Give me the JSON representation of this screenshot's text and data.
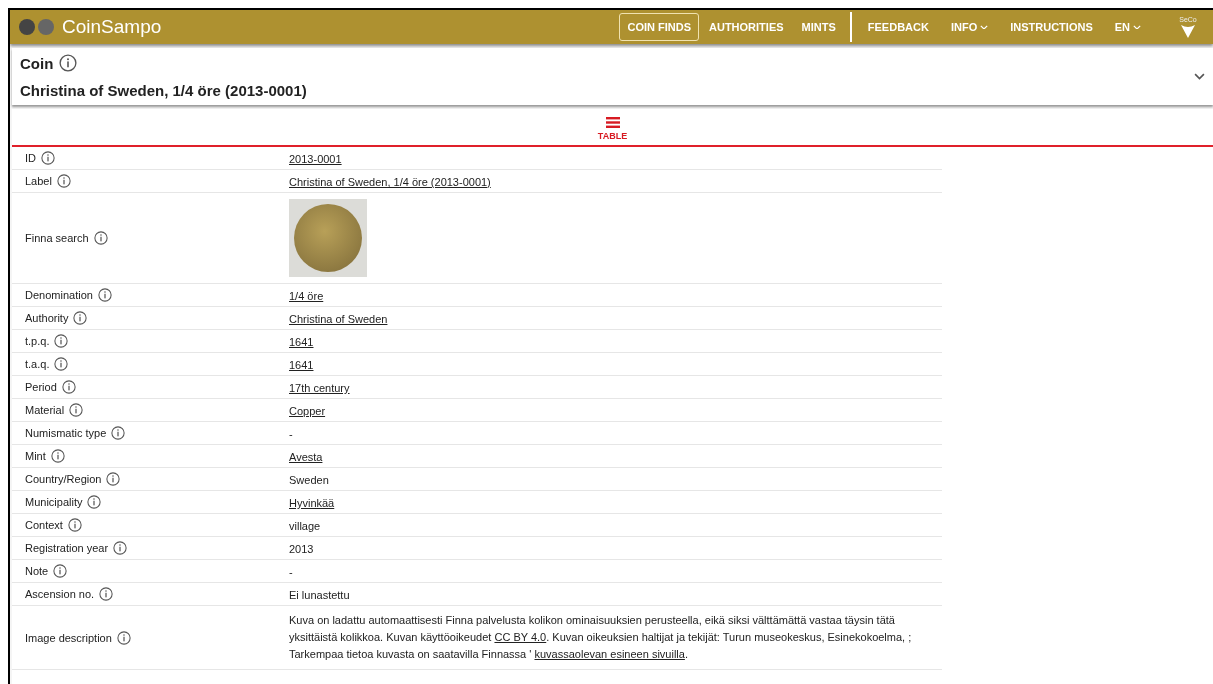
{
  "header": {
    "title": "CoinSampo",
    "nav": [
      {
        "label": "COIN FINDS",
        "selected": true,
        "dropdown": false
      },
      {
        "label": "AUTHORITIES",
        "selected": false,
        "dropdown": false
      },
      {
        "label": "MINTS",
        "selected": false,
        "dropdown": false
      }
    ],
    "nav_right": [
      {
        "label": "FEEDBACK",
        "dropdown": false
      },
      {
        "label": "INFO",
        "dropdown": true
      },
      {
        "label": "INSTRUCTIONS",
        "dropdown": false
      },
      {
        "label": "EN",
        "dropdown": true
      }
    ],
    "logo_text": "SeCo"
  },
  "panel": {
    "type": "Coin",
    "title": "Christina of Sweden, 1/4 öre (2013-0001)",
    "expanded": false
  },
  "tabs": [
    {
      "label": "TABLE",
      "selected": true
    }
  ],
  "rows": [
    {
      "label": "ID",
      "kind": "link",
      "value": "2013-0001"
    },
    {
      "label": "Label",
      "kind": "link",
      "value": "Christina of Sweden, 1/4 öre (2013-0001)"
    },
    {
      "label": "Finna search",
      "kind": "image"
    },
    {
      "label": "Denomination",
      "kind": "link",
      "value": "1/4 öre"
    },
    {
      "label": "Authority",
      "kind": "link",
      "value": "Christina of Sweden"
    },
    {
      "label": "t.p.q.",
      "kind": "link",
      "value": "1641"
    },
    {
      "label": "t.a.q.",
      "kind": "link",
      "value": "1641"
    },
    {
      "label": "Period",
      "kind": "link",
      "value": "17th century"
    },
    {
      "label": "Material",
      "kind": "link",
      "value": "Copper"
    },
    {
      "label": "Numismatic type",
      "kind": "text",
      "value": "-"
    },
    {
      "label": "Mint",
      "kind": "link",
      "value": "Avesta"
    },
    {
      "label": "Country/Region",
      "kind": "text",
      "value": "Sweden"
    },
    {
      "label": "Municipality",
      "kind": "link",
      "value": "Hyvinkää"
    },
    {
      "label": "Context",
      "kind": "text",
      "value": "village"
    },
    {
      "label": "Registration year",
      "kind": "text",
      "value": "2013"
    },
    {
      "label": "Note",
      "kind": "text",
      "value": "-"
    },
    {
      "label": "Ascension no.",
      "kind": "text",
      "value": "Ei lunastettu"
    },
    {
      "label": "Image description",
      "kind": "paragraph",
      "parts": [
        {
          "kind": "text",
          "text": "Kuva on ladattu automaattisesti Finna palvelusta kolikon ominaisuuksien perusteella, eikä siksi välttämättä vastaa täysin tätä yksittäistä kolikkoa. Kuvan käyttöoikeudet "
        },
        {
          "kind": "link",
          "text": "CC BY 4.0"
        },
        {
          "kind": "text",
          "text": ". Kuvan oikeuksien haltijat ja tekijät: Turun museokeskus, Esinekokoelma, ; Tarkempaa tietoa kuvasta on saatavilla Finnassa ' "
        },
        {
          "kind": "link",
          "text": "kuvassaolevan esineen sivuilla"
        },
        {
          "kind": "text",
          "text": "."
        }
      ]
    }
  ]
}
